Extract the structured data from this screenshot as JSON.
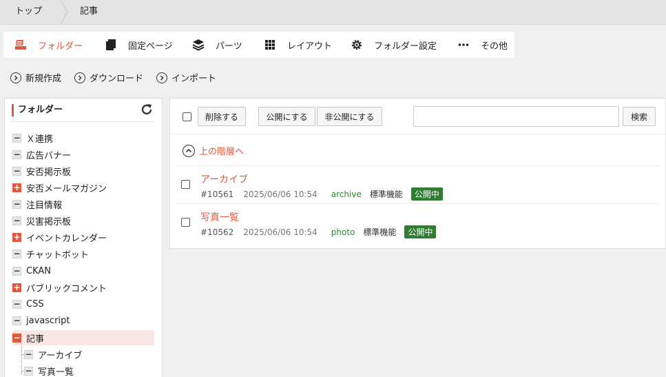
{
  "breadcrumb": {
    "home": "トップ",
    "current": "記事"
  },
  "nav": {
    "items": [
      {
        "label": "フォルダー",
        "icon": "folder-icon"
      },
      {
        "label": "固定ページ",
        "icon": "pages-icon"
      },
      {
        "label": "パーツ",
        "icon": "layers-icon"
      },
      {
        "label": "レイアウト",
        "icon": "grid-icon"
      },
      {
        "label": "フォルダー設定",
        "icon": "gear-icon"
      },
      {
        "label": "その他",
        "icon": "more-icon"
      }
    ],
    "accent_color": "#e0573a"
  },
  "actions": {
    "create": "新規作成",
    "download": "ダウンロード",
    "import": "インポート"
  },
  "sidebar": {
    "title": "フォルダー",
    "items": [
      {
        "label": "Ｘ連携",
        "toggle": "minus"
      },
      {
        "label": "広告バナー",
        "toggle": "minus"
      },
      {
        "label": "安否掲示板",
        "toggle": "minus"
      },
      {
        "label": "安否メールマガジン",
        "toggle": "plus"
      },
      {
        "label": "注目情報",
        "toggle": "minus"
      },
      {
        "label": "災害掲示板",
        "toggle": "minus"
      },
      {
        "label": "イベントカレンダー",
        "toggle": "plus"
      },
      {
        "label": "チャットボット",
        "toggle": "minus"
      },
      {
        "label": "CKAN",
        "toggle": "minus"
      },
      {
        "label": "パブリックコメント",
        "toggle": "plus"
      },
      {
        "label": "CSS",
        "toggle": "minus"
      },
      {
        "label": "javascript",
        "toggle": "minus"
      },
      {
        "label": "記事",
        "toggle": "minus-red"
      }
    ],
    "children": [
      {
        "label": "アーカイブ"
      },
      {
        "label": "写真一覧"
      }
    ]
  },
  "toolbar": {
    "delete": "削除する",
    "publish": "公開にする",
    "unpublish": "非公開にする",
    "search_value": "",
    "search_button": "検索"
  },
  "list": {
    "up_label": "上の階層へ",
    "rows": [
      {
        "title": "アーカイブ",
        "id": "#10561",
        "date": "2025/06/06 10:54",
        "path": "archive",
        "type": "標準機能",
        "status": "公開中"
      },
      {
        "title": "写真一覧",
        "id": "#10562",
        "date": "2025/06/06 10:54",
        "path": "photo",
        "type": "標準機能",
        "status": "公開中"
      }
    ]
  }
}
